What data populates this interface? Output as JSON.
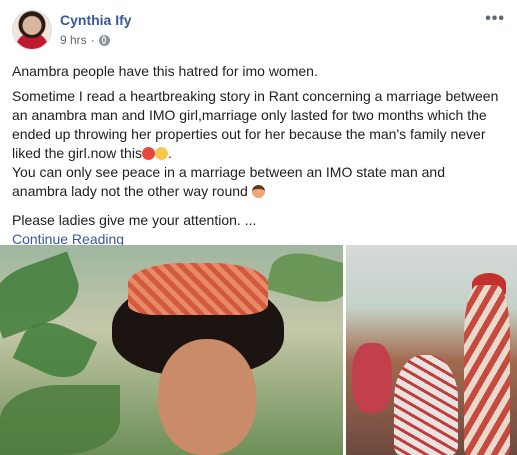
{
  "author": {
    "name": "Cynthia Ify",
    "time": "9 hrs",
    "separator": "·"
  },
  "menu_label": "•••",
  "post": {
    "line1": "Anambra people have this hatred for imo women.",
    "line2": "Sometime I read a heartbreaking story in Rant concerning a marriage between an anambra man and IMO girl,marriage only lasted for two months which the ended up throwing her properties out for her because the man's family never liked the girl.now this",
    "line2_end": ".",
    "line3": "You can only see peace in a marriage between an IMO state man and anambra lady not the other way round",
    "line4": "Please ladies give me your attention. ...",
    "continue": "Continue Reading"
  },
  "icons": [
    "globe-icon",
    "angry-emoji-icon",
    "crying-emoji-icon",
    "woman-gesturing-emoji-icon",
    "more-options-icon"
  ]
}
